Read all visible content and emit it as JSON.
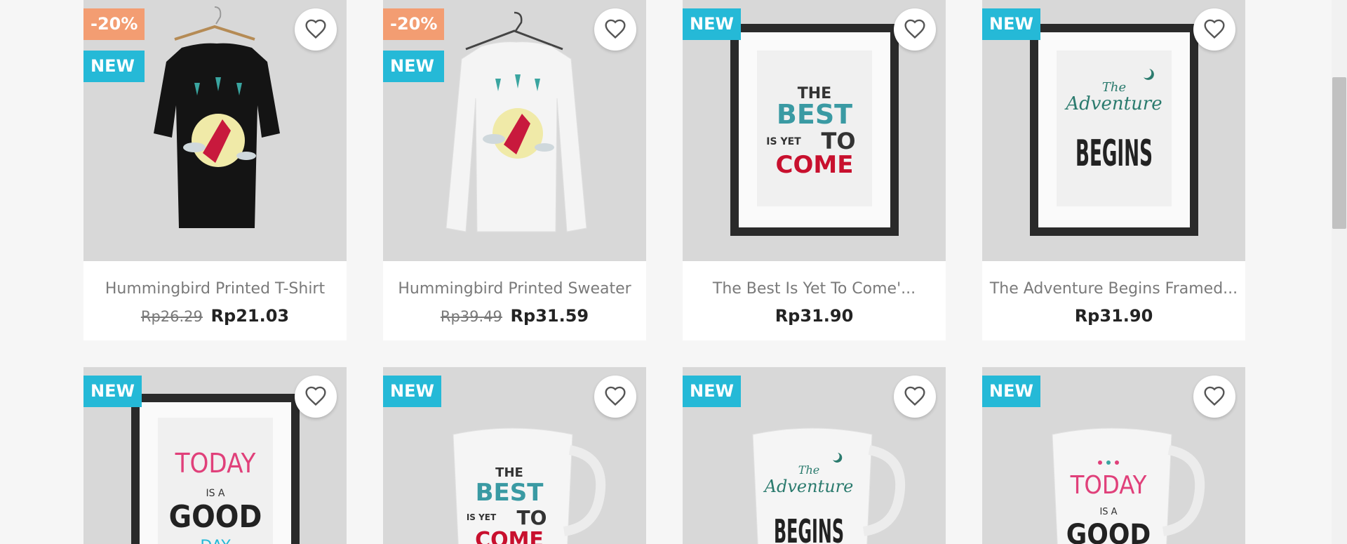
{
  "products_row1": [
    {
      "title": "Hummingbird Printed T-Shirt",
      "badges": [
        "-20%",
        "NEW"
      ],
      "old_price": "Rp26.29",
      "price": "Rp21.03",
      "image": "black-tshirt-hummingbird"
    },
    {
      "title": "Hummingbird Printed Sweater",
      "badges": [
        "-20%",
        "NEW"
      ],
      "old_price": "Rp39.49",
      "price": "Rp31.59",
      "image": "white-sweater-hummingbird"
    },
    {
      "title": "The Best Is Yet To Come'...",
      "badges": [
        "NEW"
      ],
      "old_price": "",
      "price": "Rp31.90",
      "image": "framed-poster-best-is-yet"
    },
    {
      "title": "The Adventure Begins Framed...",
      "badges": [
        "NEW"
      ],
      "old_price": "",
      "price": "Rp31.90",
      "image": "framed-poster-adventure"
    }
  ],
  "products_row2": [
    {
      "badges": [
        "NEW"
      ],
      "image": "framed-poster-today-good-day"
    },
    {
      "badges": [
        "NEW"
      ],
      "image": "mug-best-is-yet"
    },
    {
      "badges": [
        "NEW"
      ],
      "image": "mug-adventure"
    },
    {
      "badges": [
        "NEW"
      ],
      "image": "mug-today-good-day"
    }
  ],
  "poster_text": {
    "best_line1": "THE",
    "best_line2": "BEST",
    "best_line3": "IS YET",
    "best_line4": "TO",
    "best_line5": "COME",
    "adv_line1": "The",
    "adv_line2": "Adventure",
    "adv_line3": "BEGINS",
    "today_line1": "TODAY",
    "today_line2": "IS A",
    "today_line3": "GOOD",
    "today_line4": "DAY"
  },
  "icons": {
    "wishlist": "heart-outline-icon"
  },
  "colors": {
    "badge_new": "#25b9d7",
    "badge_discount": "#f39d72",
    "teal": "#3a9aa3",
    "red": "#c8102e",
    "pink": "#e0407a"
  }
}
